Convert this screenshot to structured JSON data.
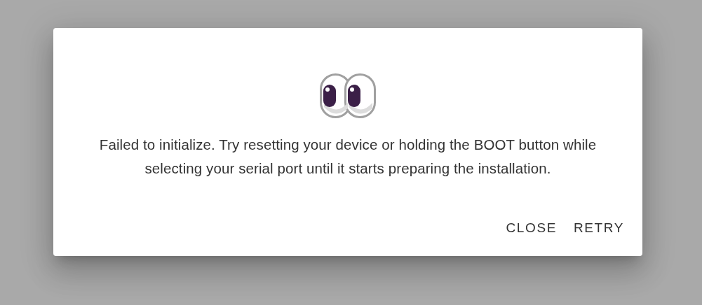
{
  "dialog": {
    "message": "Failed to initialize. Try resetting your device or holding the BOOT button while selecting your serial port until it starts preparing the installation.",
    "buttons": [
      {
        "label": "CLOSE"
      },
      {
        "label": "RETRY"
      }
    ]
  }
}
